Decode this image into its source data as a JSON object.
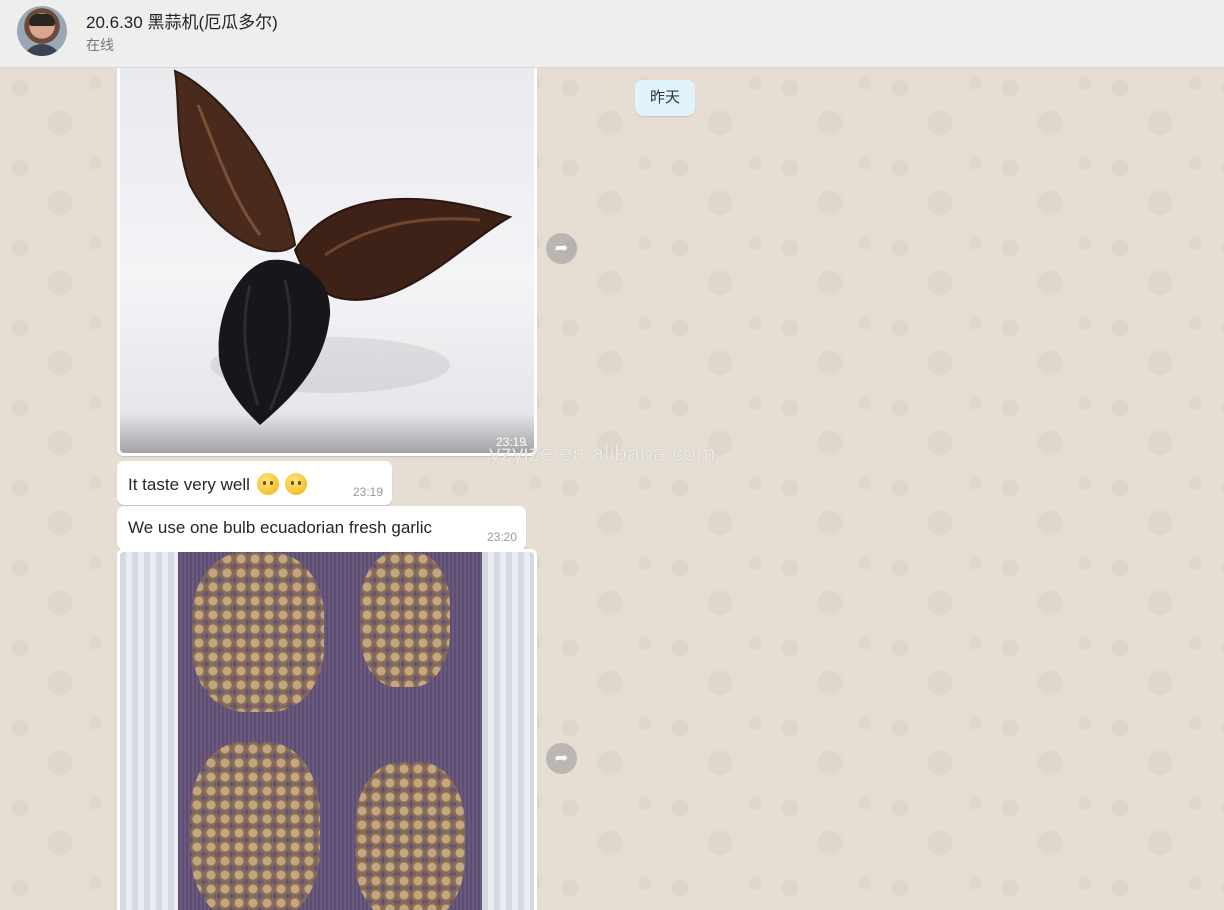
{
  "header": {
    "title": "20.6.30 黑蒜机(厄瓜多尔)",
    "status": "在线"
  },
  "chat": {
    "date_separator": "昨天",
    "messages": [
      {
        "type": "image",
        "subject": "black garlic cloves",
        "time": "23:19"
      },
      {
        "type": "text",
        "text": "It taste very well",
        "emoji": [
          "slightly-smiling-face",
          "smirking-face"
        ],
        "time": "23:19"
      },
      {
        "type": "text",
        "text": "We use one bulb ecuadorian fresh garlic",
        "time": "23:20"
      },
      {
        "type": "image",
        "subject": "garlic bulbs in crate",
        "time": ""
      }
    ]
  },
  "watermark": "yzyize.en.alibaba.com",
  "colors": {
    "header_bg": "#eeeeee",
    "chat_bg": "#e6ded3",
    "bubble_bg": "#ffffff",
    "date_pill_bg": "#e1f3fb"
  }
}
